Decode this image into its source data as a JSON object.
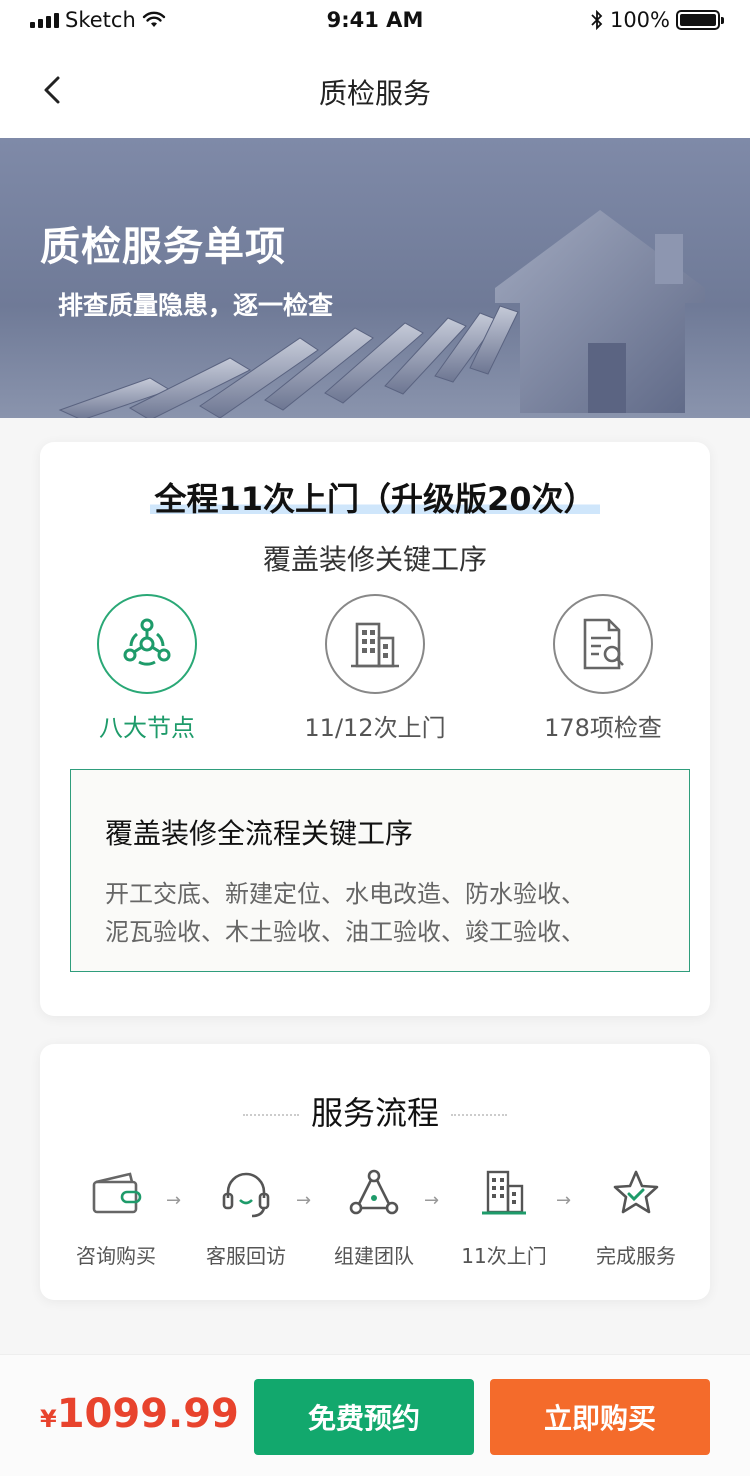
{
  "status": {
    "carrier": "Sketch",
    "time": "9:41 AM",
    "battery": "100%"
  },
  "nav": {
    "title": "质检服务"
  },
  "banner": {
    "title": "质检服务单项",
    "subtitle": "排查质量隐患，逐一检查"
  },
  "summary": {
    "headline": "全程11次上门（升级版20次）",
    "subtitle": "覆盖装修关键工序",
    "features": [
      {
        "label": "八大节点",
        "icon": "nodes-icon",
        "active": true
      },
      {
        "label": "11/12次上门",
        "icon": "building-icon",
        "active": false
      },
      {
        "label": "178项检查",
        "icon": "document-search-icon",
        "active": false
      }
    ],
    "detail": {
      "title": "覆盖装修全流程关键工序",
      "line1": "开工交底、新建定位、水电改造、防水验收、",
      "line2": "泥瓦验收、木土验收、油工验收、竣工验收、"
    }
  },
  "process": {
    "title": "服务流程",
    "steps": [
      {
        "label": "咨询购买",
        "icon": "wallet-icon"
      },
      {
        "label": "客服回访",
        "icon": "headset-icon"
      },
      {
        "label": "组建团队",
        "icon": "team-icon"
      },
      {
        "label": "11次上门",
        "icon": "building-icon"
      },
      {
        "label": "完成服务",
        "icon": "star-check-icon"
      }
    ]
  },
  "footer": {
    "currency": "¥",
    "price": "1099.99",
    "reserve_label": "免费预约",
    "buy_label": "立即购买"
  },
  "colors": {
    "accent_green": "#12a86d",
    "accent_orange": "#f46b2b",
    "price_red": "#e8432d",
    "banner_blue": "#7f8aa8"
  }
}
